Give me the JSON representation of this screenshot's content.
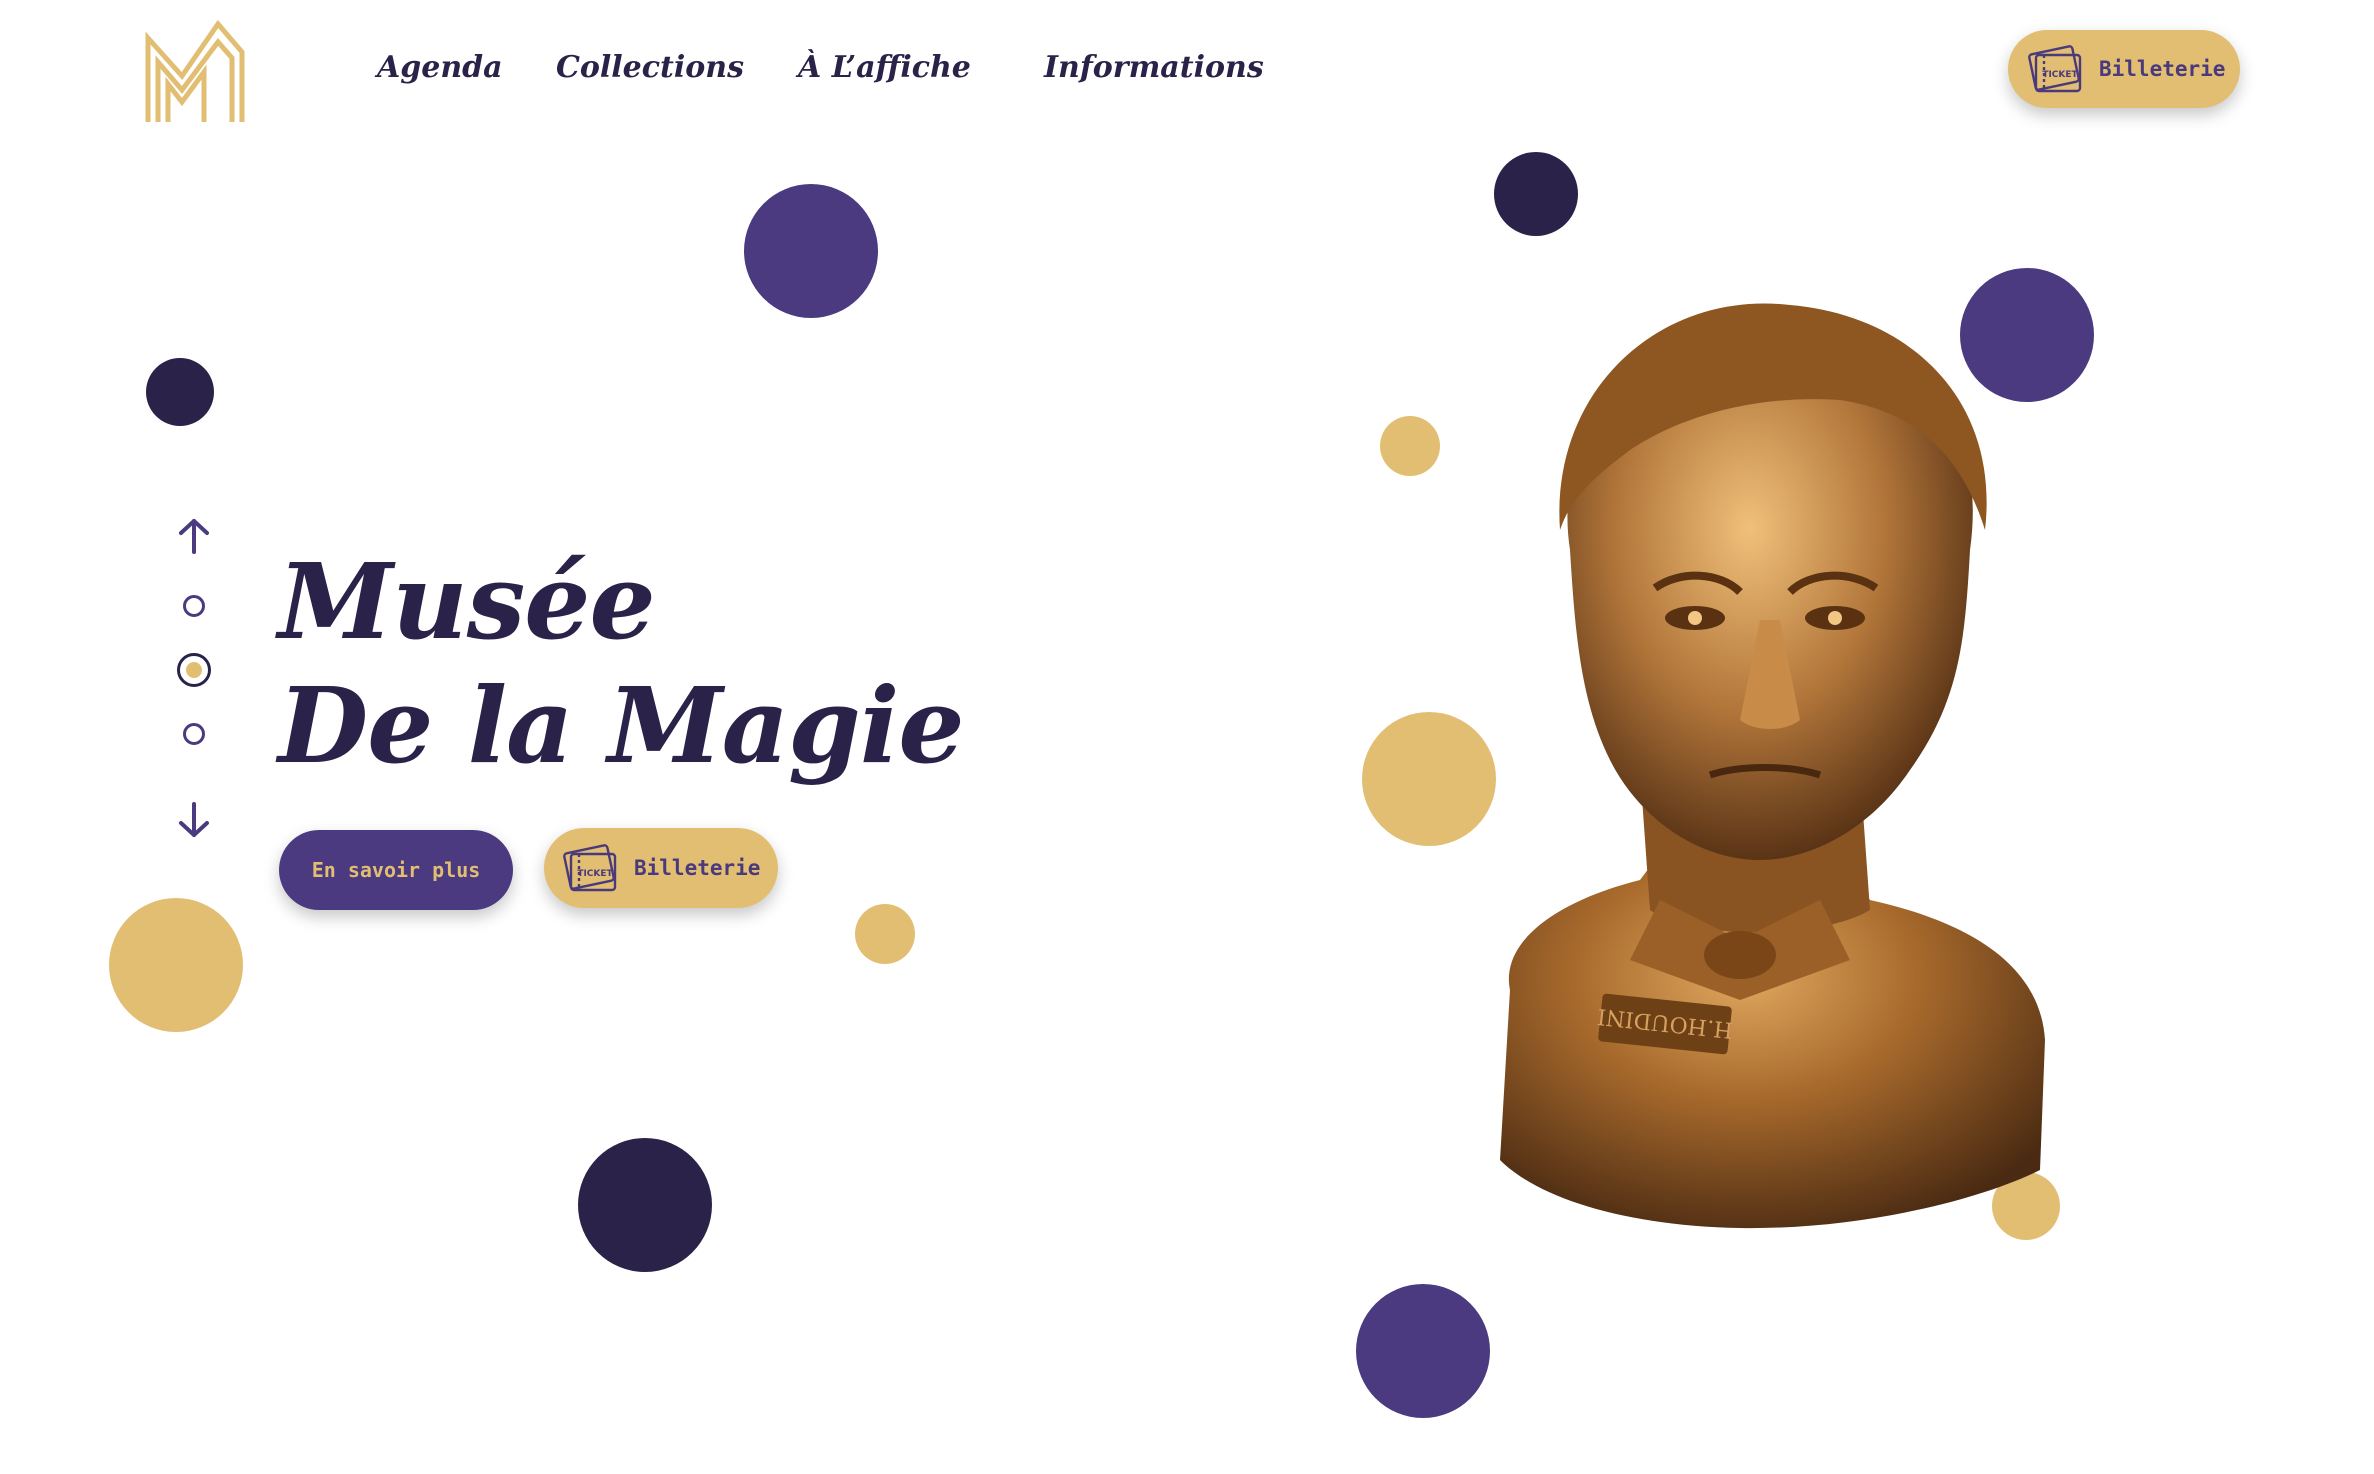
{
  "nav": {
    "items": [
      {
        "label": "Agenda"
      },
      {
        "label": "Collections"
      },
      {
        "label": "À L’affiche"
      },
      {
        "label": "Informations"
      }
    ],
    "ticket_label": "Billeterie"
  },
  "hero": {
    "title_line1": "Musée",
    "title_line2": "De la Magie",
    "learn_more_label": "En savoir plus",
    "ticket_label": "Billeterie",
    "ticket_icon_text": "TICKET",
    "image_alt": "Bronze bust of H. Houdini",
    "bust_plaque": "H.HOUDINI"
  },
  "pager": {
    "count": 3,
    "active_index": 1
  },
  "colors": {
    "dark": "#2a2248",
    "purple": "#4b3a80",
    "gold": "#e2be72",
    "bronze": "#a86a2c"
  }
}
